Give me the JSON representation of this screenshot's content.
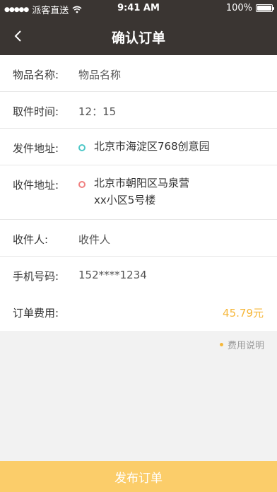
{
  "status_bar": {
    "signal": "●●●●●",
    "carrier": "派客直送",
    "time": "9:41 AM",
    "battery": "100%",
    "battery_level": 1.0
  },
  "nav": {
    "title": "确认订单"
  },
  "form": {
    "item_name": {
      "label": "物品名称:",
      "value": "物品名称"
    },
    "pickup_time": {
      "label": "取件时间:",
      "value": "12：15"
    },
    "sender_address": {
      "label": "发件地址:",
      "value": "北京市海淀区768创意园",
      "dot_color": "#4fc8c8"
    },
    "receiver_address": {
      "label": "收件地址:",
      "line1": "北京市朝阳区马泉营",
      "line2": "xx小区5号楼",
      "dot_color": "#f08080"
    },
    "receiver": {
      "label": "收件人:",
      "value": "收件人"
    },
    "phone": {
      "label": "手机号码:",
      "value": "152****1234"
    }
  },
  "fee": {
    "label": "订单费用:",
    "amount": "45.79元",
    "note": "费用说明",
    "accent": "#f6b73a"
  },
  "submit": {
    "label": "发布订单",
    "color": "#fbcd6a"
  }
}
